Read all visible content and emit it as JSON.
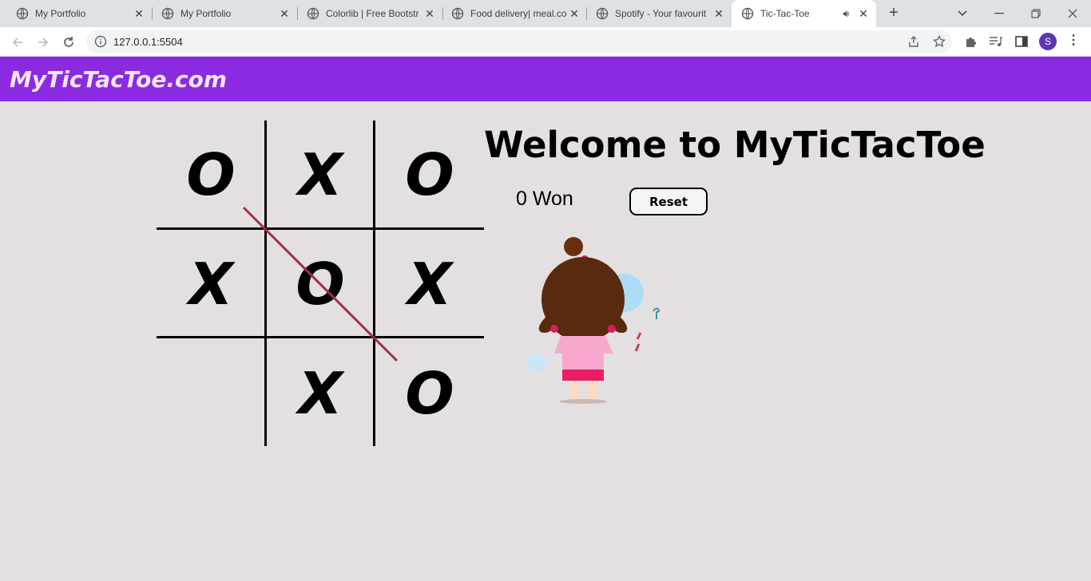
{
  "browser": {
    "tabs": [
      {
        "title": "My Portfolio",
        "active": false
      },
      {
        "title": "My Portfolio",
        "active": false
      },
      {
        "title": "Colorlib | Free Bootstr",
        "active": false
      },
      {
        "title": "Food delivery| meal.co",
        "active": false
      },
      {
        "title": "Spotify - Your favourit",
        "active": false
      },
      {
        "title": "Tic-Tac-Toe",
        "active": true
      }
    ],
    "url": "127.0.0.1:5504",
    "profile_initial": "S"
  },
  "page": {
    "brand": "MyTicTacToe.com",
    "welcome": "Welcome to MyTicTacToe",
    "status": "0 Won",
    "reset_label": "Reset"
  },
  "board": {
    "cells": [
      "O",
      "X",
      "O",
      "X",
      "O",
      "X",
      "",
      "X",
      "O"
    ]
  },
  "colors": {
    "navbar": "#8a2be2",
    "brand_text": "#f7e6f5",
    "page_bg": "#e4e0e1",
    "strike_line": "#a0303c"
  }
}
